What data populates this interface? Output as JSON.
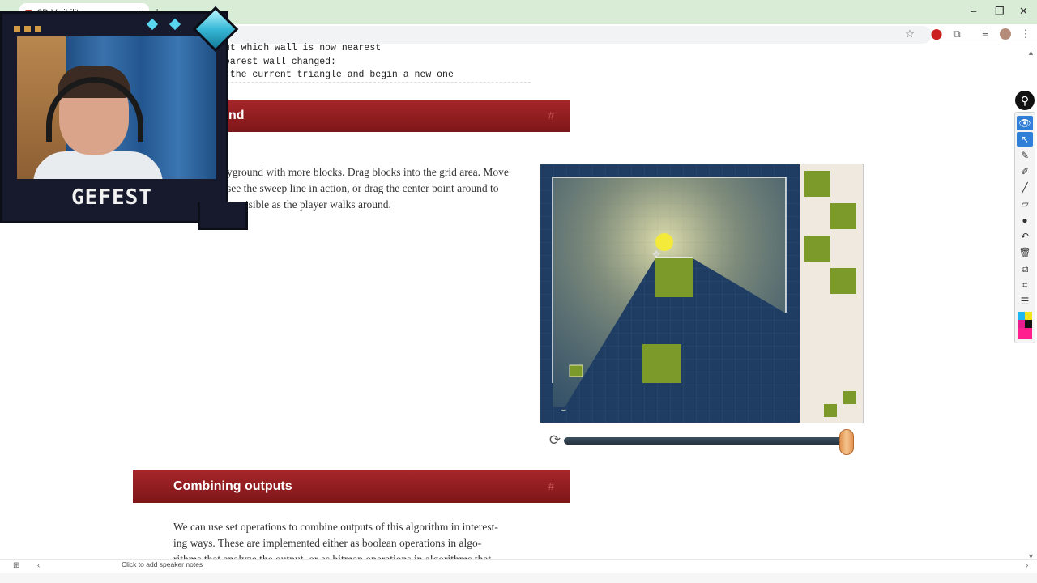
{
  "browser": {
    "tab_title": "2D Visibility",
    "tab_close": "×",
    "new_tab": "+",
    "window": {
      "minimize": "–",
      "restore": "❐",
      "close": "✕"
    },
    "toolbar_icons": [
      "☆",
      "⬤",
      "⧉",
      "≡",
      "⋮"
    ]
  },
  "code_lines": [
    "out which wall is now nearest",
    "nearest wall changed:",
    "l the current triangle and begin a new one"
  ],
  "section1": {
    "title_partial": "nd",
    "anchor": "#"
  },
  "paragraph1": [
    "yground with more blocks. Drag blocks into the grid area. Move",
    "see the sweep line in action, or drag the center point around to",
    "be visible as the player walks around."
  ],
  "demo": {
    "colors": {
      "grid_bg": "#1f3d62",
      "block": "#7c9a2a",
      "light": "#e6e8b4",
      "tray": "#efe9e0",
      "player": "#f3ea3a"
    },
    "minus_label": "–"
  },
  "slider": {
    "reset_icon": "⟳",
    "value_fraction": 1.0
  },
  "section2": {
    "title": "Combining outputs",
    "anchor": "#"
  },
  "paragraph2": [
    "We can use set operations to combine outputs of this algorithm in interest-",
    "ing ways. These are implemented either as boolean operations in algo-",
    "rithms that analyze the output, or as bitmap operations in algorithms that"
  ],
  "palette": {
    "top_icon": "⚲",
    "tools": [
      "👁",
      "↖",
      "✎",
      "✐",
      "╱",
      "▱",
      "●",
      "↶",
      "🗑",
      "⧉",
      "⌗",
      "☰"
    ]
  },
  "webcam": {
    "name": "GEFEST"
  },
  "bottom": {
    "notes_text": "Click to add speaker notes",
    "grid_icon": "⊞",
    "collapse_icon": "‹",
    "arrow_icon": "›"
  }
}
